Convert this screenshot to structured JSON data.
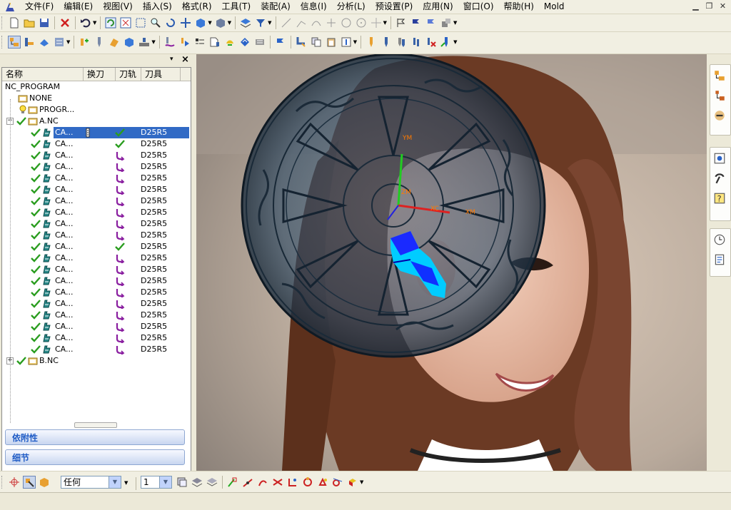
{
  "menubar": {
    "items": [
      "文件(F)",
      "编辑(E)",
      "视图(V)",
      "插入(S)",
      "格式(R)",
      "工具(T)",
      "装配(A)",
      "信息(I)",
      "分析(L)",
      "预设置(P)",
      "应用(N)",
      "窗口(O)",
      "帮助(H)",
      "Mold"
    ]
  },
  "navigator": {
    "columns": [
      "名称",
      "换刀",
      "刀轨",
      "刀具"
    ],
    "root": "NC_PROGRAM",
    "none_label": "NONE",
    "progr_label": "PROGR...",
    "group_a": "A.NC",
    "group_b": "B.NC",
    "op_name": "CA...",
    "tool": "D25R5",
    "ops_path_status": [
      "check",
      "check",
      "path",
      "path",
      "path",
      "path",
      "path",
      "path",
      "path",
      "path",
      "check",
      "path",
      "path",
      "path",
      "path",
      "path",
      "path",
      "path",
      "path",
      "path"
    ],
    "selected_index": 0
  },
  "panels": {
    "dependencies": "依附性",
    "details": "细节"
  },
  "bottom": {
    "filter_value": "任何",
    "layer_value": "1"
  },
  "viewport": {
    "axis_labels": [
      "YM",
      "ZM",
      "XC",
      "XM"
    ]
  },
  "colors": {
    "selection": "#316ac5",
    "check": "#2a9d1f",
    "path": "#8a1fa0",
    "accent": "#215dc6"
  }
}
